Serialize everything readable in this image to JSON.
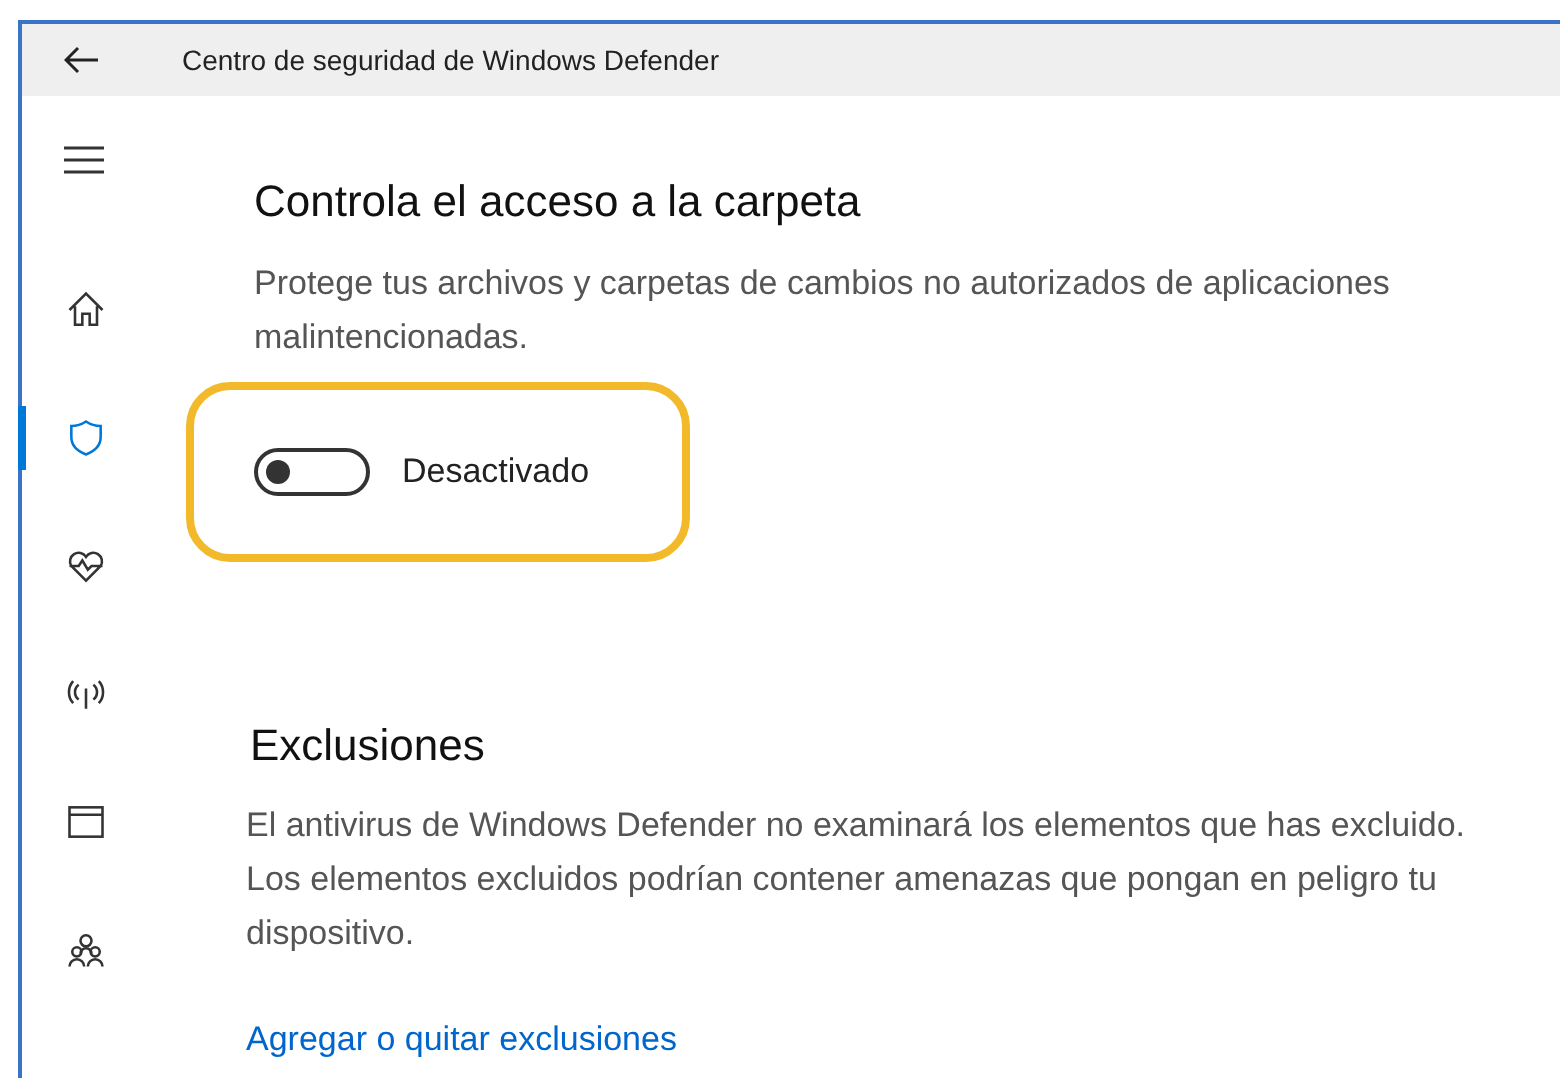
{
  "window": {
    "title": "Centro de seguridad de Windows Defender"
  },
  "sidebar": {
    "items": [
      {
        "kind": "home",
        "selected": false
      },
      {
        "kind": "shield",
        "selected": true
      },
      {
        "kind": "heart",
        "selected": false
      },
      {
        "kind": "antenna",
        "selected": false
      },
      {
        "kind": "browser",
        "selected": false
      },
      {
        "kind": "family",
        "selected": false
      }
    ]
  },
  "folder_access": {
    "title": "Controla el acceso a la carpeta",
    "description": "Protege tus archivos y carpetas de cambios no autorizados de aplicaciones malintencionadas.",
    "toggle": {
      "on": false,
      "label": "Desactivado",
      "highlighted": true
    }
  },
  "exclusions": {
    "title": "Exclusiones",
    "description": "El antivirus de Windows Defender no examinará los elementos que has excluido. Los elementos excluidos podrían contener amenazas que pongan en peligro tu dispositivo.",
    "link": "Agregar o quitar exclusiones"
  }
}
